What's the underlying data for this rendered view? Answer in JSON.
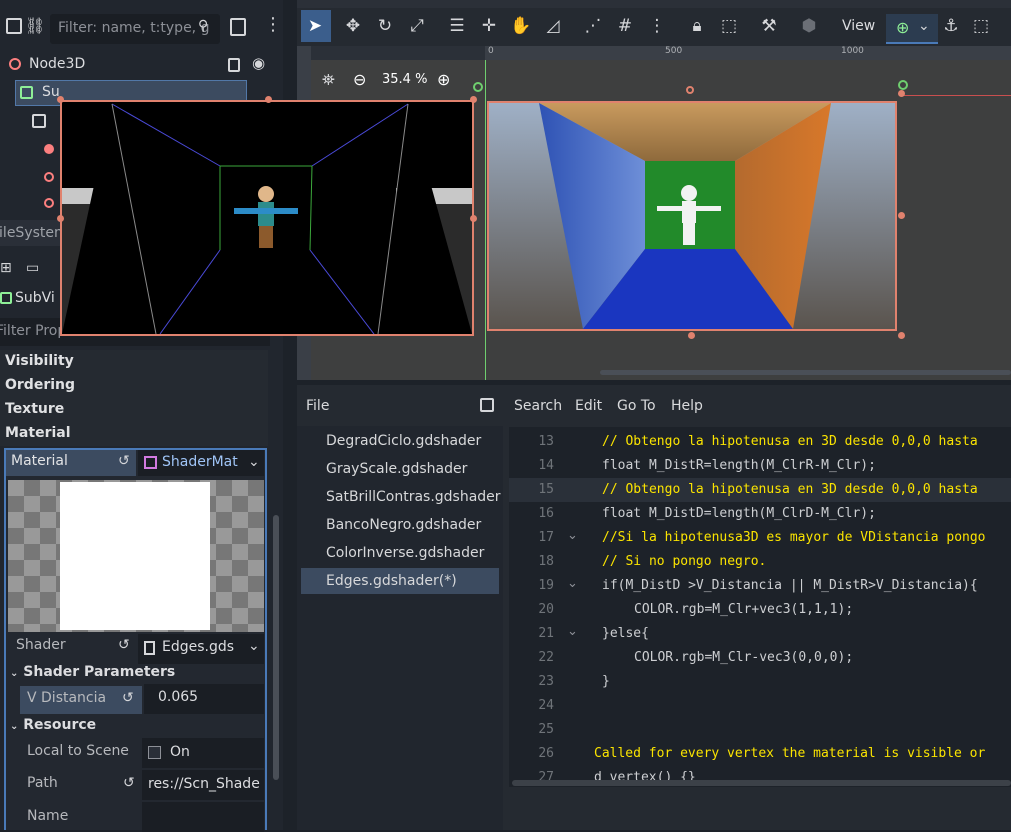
{
  "scene_dock": {
    "filter_placeholder": "Filter: name, t:type, g",
    "root_node": "Node3D",
    "sub_node": "Su",
    "filesystem_label": "FileSystem",
    "fs_item": "SubVi",
    "filter_props_label": "Filter Prop"
  },
  "inspector": {
    "sections": [
      "Visibility",
      "Ordering",
      "Texture",
      "Material"
    ],
    "material_label": "Material",
    "material_value": "ShaderMat",
    "shader_label": "Shader",
    "shader_value": "Edges.gds",
    "shader_params_label": "Shader Parameters",
    "v_distancia_label": "V Distancia",
    "v_distancia_value": "0.065",
    "resource_label": "Resource",
    "local_to_scene_label": "Local to Scene",
    "local_to_scene_value": "On",
    "path_label": "Path",
    "path_value": "res://Scn_Shade",
    "name_label": "Name"
  },
  "viewport": {
    "zoom": "35.4 %",
    "view_label": "View",
    "ruler_ticks": [
      "0",
      "500",
      "1000"
    ]
  },
  "script_editor": {
    "menu": [
      "File",
      "Search",
      "Edit",
      "Go To",
      "Help"
    ],
    "files": [
      "DegradCiclo.gdshader",
      "GrayScale.gdshader",
      "SatBrillContras.gdshader",
      "BancoNegro.gdshader",
      "ColorInverse.gdshader",
      "Edges.gdshader(*)"
    ],
    "active_file_index": 5,
    "line_numbers": [
      "13",
      "14",
      "15",
      "16",
      "17",
      "18",
      "19",
      "20",
      "21",
      "22",
      "23",
      "24",
      "25",
      "26",
      "27"
    ],
    "code": [
      "// Obtengo la hipotenusa en 3D desde 0,0,0 hasta",
      "float M_DistR=length(M_ClrR-M_Clr);",
      "// Obtengo la hipotenusa en 3D desde 0,0,0 hasta",
      "float M_DistD=length(M_ClrD-M_Clr);",
      "//Si la hipotenusa3D es mayor de VDistancia pongo",
      "// Si no pongo negro.",
      "if(M_DistD >V_Distancia || M_DistR>V_Distancia){",
      "COLOR.rgb=M_Clr+vec3(1,1,1);",
      "}else{",
      "COLOR.rgb=M_Clr-vec3(0,0,0);",
      "}",
      "",
      "",
      "Called for every vertex the material is visible or",
      "d vertex() {}"
    ]
  },
  "colors": {
    "accent": "#4a7ab8",
    "selection_border": "#e0826e"
  }
}
